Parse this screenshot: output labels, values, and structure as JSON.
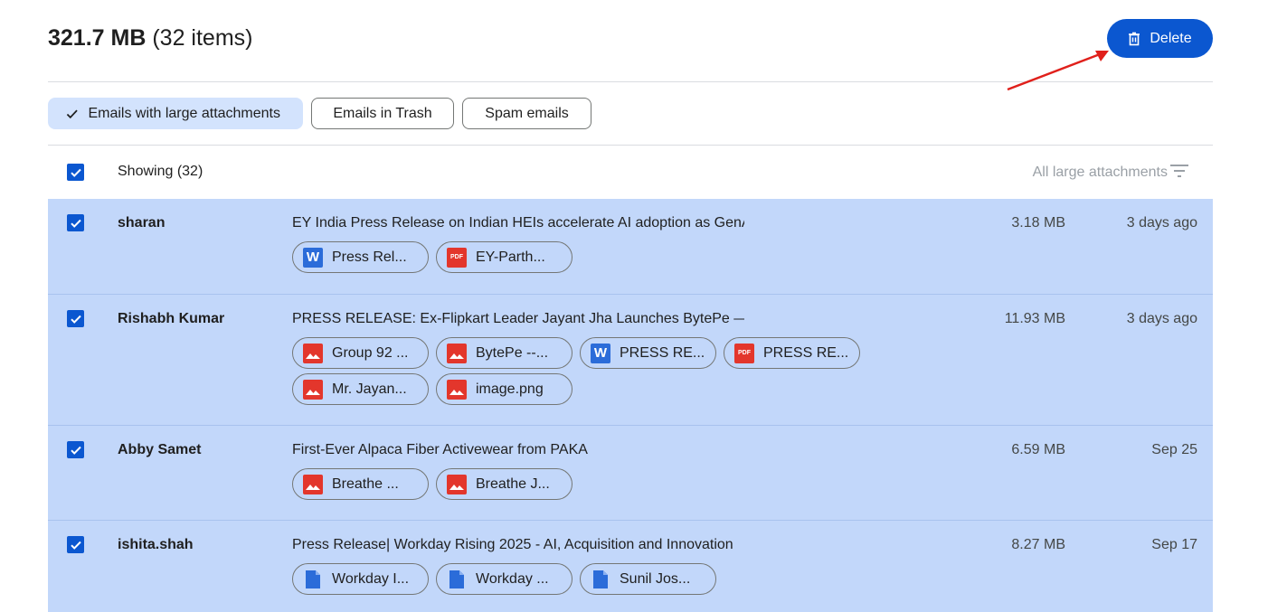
{
  "storage": {
    "size": "321.7 MB",
    "count": "(32 items)"
  },
  "toolbar": {
    "delete_label": "Delete"
  },
  "filters": [
    {
      "label": "Emails with large attachments",
      "active": true
    },
    {
      "label": "Emails in Trash",
      "active": false
    },
    {
      "label": "Spam emails",
      "active": false
    }
  ],
  "list": {
    "showing": "Showing (32)",
    "filter_label": "All large attachments",
    "rows": [
      {
        "sender": "sharan",
        "subject": "EY India Press Release on Indian HEIs accelerate AI adoption as GenAI ...",
        "size": "3.18 MB",
        "date": "3 days ago",
        "attachments": [
          {
            "type": "word",
            "name": "Press Rel..."
          },
          {
            "type": "pdf",
            "name": "EY-Parth..."
          }
        ]
      },
      {
        "sender": "Rishabh Kumar",
        "subject": "PRESS RELEASE: Ex-Flipkart Leader Jayant Jha Launches BytePe — In...",
        "size": "11.93 MB",
        "date": "3 days ago",
        "attachments": [
          {
            "type": "img",
            "name": "Group 92 ..."
          },
          {
            "type": "img",
            "name": "BytePe --..."
          },
          {
            "type": "word",
            "name": "PRESS RE..."
          },
          {
            "type": "pdf",
            "name": "PRESS RE..."
          },
          {
            "type": "img",
            "name": "Mr. Jayan..."
          },
          {
            "type": "img",
            "name": "image.png"
          }
        ]
      },
      {
        "sender": "Abby Samet",
        "subject": "First-Ever Alpaca Fiber Activewear from PAKA",
        "size": "6.59 MB",
        "date": "Sep 25",
        "attachments": [
          {
            "type": "img",
            "name": "Breathe ..."
          },
          {
            "type": "img",
            "name": "Breathe J..."
          }
        ]
      },
      {
        "sender": "ishita.shah",
        "subject": "Press Release| Workday Rising 2025 - AI, Acquisition and Innovation",
        "size": "8.27 MB",
        "date": "Sep 17",
        "attachments": [
          {
            "type": "doc",
            "name": "Workday I..."
          },
          {
            "type": "doc",
            "name": "Workday ..."
          },
          {
            "type": "doc",
            "name": "Sunil Jos..."
          }
        ]
      }
    ]
  },
  "colors": {
    "accent": "#0b57d0",
    "row_selected": "#c2d7fa",
    "chip_active": "#d3e3fd",
    "annotation_arrow": "#e0201b"
  }
}
